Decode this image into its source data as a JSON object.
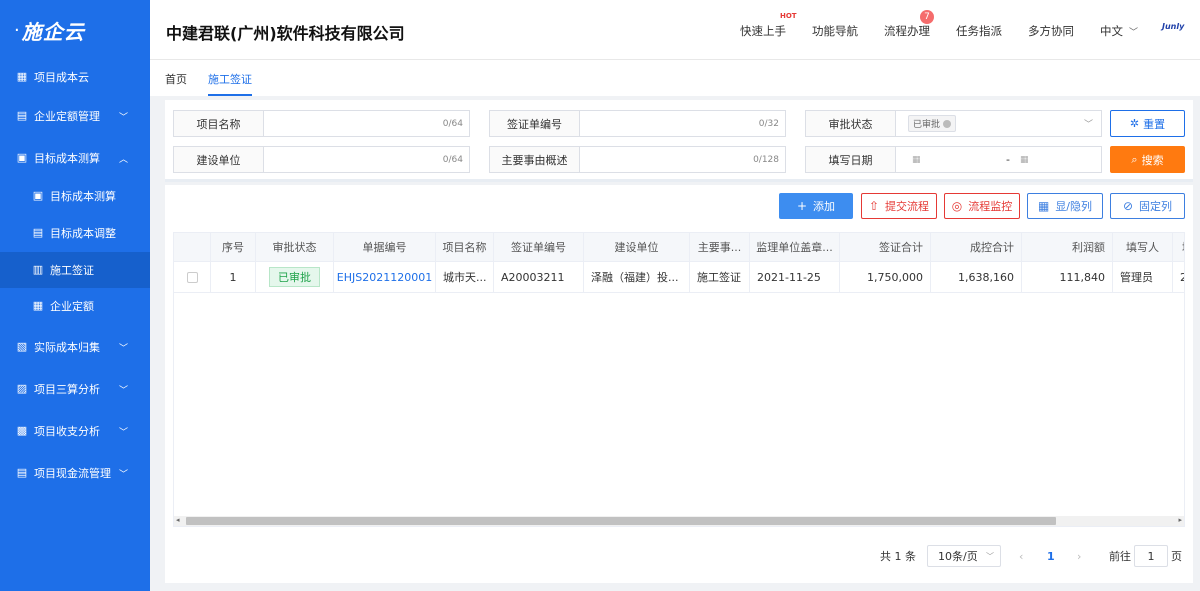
{
  "sidebar": {
    "logo": "施企云",
    "items": [
      {
        "label": "项目成本云"
      },
      {
        "label": "企业定额管理"
      },
      {
        "label": "目标成本测算"
      },
      {
        "label": "目标成本测算"
      },
      {
        "label": "目标成本调整"
      },
      {
        "label": "施工签证"
      },
      {
        "label": "企业定额"
      },
      {
        "label": "实际成本归集"
      },
      {
        "label": "项目三算分析"
      },
      {
        "label": "项目收支分析"
      },
      {
        "label": "项目现金流管理"
      }
    ]
  },
  "header": {
    "company": "中建君联(广州)软件科技有限公司",
    "hot": "HOT",
    "nav": [
      "快速上手",
      "功能导航",
      "流程办理",
      "任务指派",
      "多方协同"
    ],
    "badge": "7",
    "lang": "中文",
    "brand": "Junly"
  },
  "tabs": [
    "首页",
    "施工签证"
  ],
  "filter": {
    "project_name": {
      "label": "项目名称",
      "count": "0/64"
    },
    "visa_no": {
      "label": "签证单编号",
      "count": "0/32"
    },
    "approval": {
      "label": "审批状态",
      "tag": "已审批"
    },
    "build_unit": {
      "label": "建设单位",
      "count": "0/64"
    },
    "summary": {
      "label": "主要事由概述",
      "count": "0/128"
    },
    "fill_date": {
      "label": "填写日期",
      "sep": "-"
    },
    "reset": "重置",
    "search": "搜索"
  },
  "toolbar": {
    "add": "添加",
    "submit": "提交流程",
    "monitor": "流程监控",
    "columns": "显/隐列",
    "pin": "固定列"
  },
  "table": {
    "headers": [
      "序号",
      "审批状态",
      "单据编号",
      "项目名称",
      "签证单编号",
      "建设单位",
      "主要事...",
      "监理单位盖章...",
      "签证合计",
      "成控合计",
      "利润额",
      "填写人",
      "填"
    ],
    "rows": [
      {
        "idx": "1",
        "status": "已审批",
        "doc_no": "EHJS2021120001",
        "project": "城市天...",
        "visa_no": "A20003211",
        "build_unit": "泽融（福建）投...",
        "reason": "施工签证",
        "seal_date": "2021-11-25",
        "visa_total": "1,750,000",
        "control_total": "1,638,160",
        "profit": "111,840",
        "filler": "管理员",
        "extra": "2"
      }
    ]
  },
  "pager": {
    "total": "共 1 条",
    "size": "10条/页",
    "page": "1",
    "goto": "前往",
    "goto_val": "1",
    "unit": "页"
  },
  "colors": {
    "sidebar": "#1e6fe8",
    "accent": "#1e6fe8",
    "search": "#ff7a10",
    "danger": "#e53935",
    "success": "#1fa34a"
  }
}
